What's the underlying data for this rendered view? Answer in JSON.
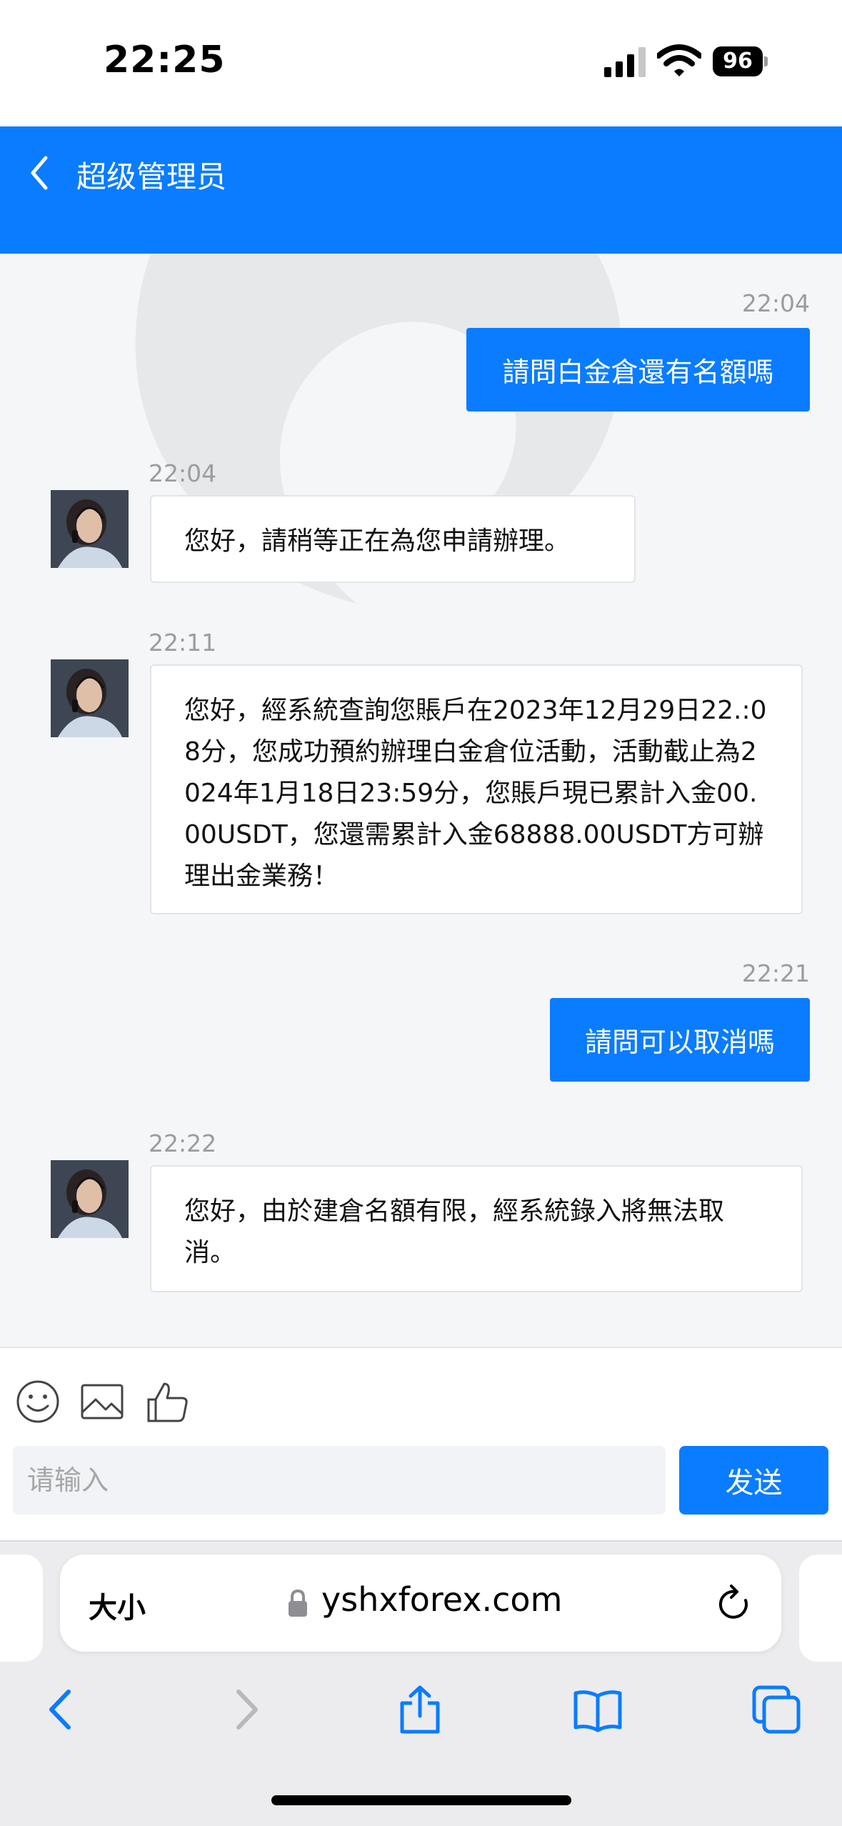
{
  "status_bar": {
    "time": "22:25",
    "battery": "96"
  },
  "header": {
    "title": "超级管理员"
  },
  "messages": [
    {
      "direction": "out",
      "time": "22:04",
      "text": "請問白金倉還有名額嗎"
    },
    {
      "direction": "in",
      "time": "22:04",
      "text": "您好，請稍等正在為您申請辦理。"
    },
    {
      "direction": "in",
      "time": "22:11",
      "text": "您好，經系統查詢您賬戶在2023年12月29日22.:08分，您成功預約辦理白金倉位活動，活動截止為2024年1月18日23:59分，您賬戶現已累計入金00.00USDT，您還需累計入金68888.00USDT方可辦理出金業務！"
    },
    {
      "direction": "out",
      "time": "22:21",
      "text": "請問可以取消嗎"
    },
    {
      "direction": "in",
      "time": "22:22",
      "text": "您好，由於建倉名額有限，經系統錄入將無法取消。"
    }
  ],
  "input": {
    "placeholder": "请输入",
    "send_label": "发送"
  },
  "toolbar": {
    "icons": [
      "emoji-icon",
      "image-icon",
      "thumbs-up-icon"
    ]
  },
  "browser": {
    "text_size_label": "大小",
    "url": "yshxforex.com",
    "nav_icons": [
      "back-icon",
      "forward-icon",
      "share-icon",
      "bookmarks-icon",
      "tabs-icon"
    ]
  },
  "colors": {
    "accent": "#0a7cff",
    "chat_bg": "#f5f6f8",
    "timestamp": "#9c9c9c"
  }
}
